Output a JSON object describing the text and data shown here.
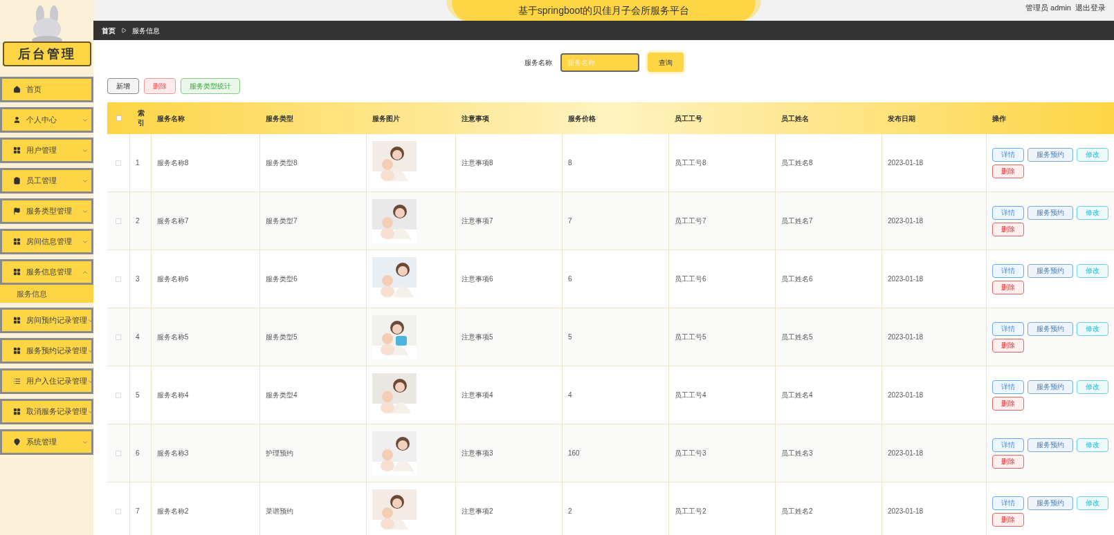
{
  "header": {
    "title": "基于springboot的贝佳月子会所服务平台",
    "user": "管理员 admin",
    "logout": "退出登录"
  },
  "sidebar": {
    "title": "后台管理",
    "menu": [
      {
        "label": "首页"
      },
      {
        "label": "个人中心",
        "expanded": false
      },
      {
        "label": "用户管理",
        "expanded": false
      },
      {
        "label": "员工管理",
        "expanded": false
      },
      {
        "label": "服务类型管理",
        "expanded": false
      },
      {
        "label": "房间信息管理",
        "expanded": false
      },
      {
        "label": "服务信息管理",
        "expanded": true,
        "children": [
          {
            "label": "服务信息",
            "selected": true
          }
        ]
      },
      {
        "label": "房间预约记录管理",
        "expanded": false
      },
      {
        "label": "服务预约记录管理",
        "expanded": false
      },
      {
        "label": "用户入住记录管理",
        "expanded": false
      },
      {
        "label": "取消服务记录管理",
        "expanded": false
      },
      {
        "label": "系统管理",
        "expanded": false
      }
    ]
  },
  "breadcrumb": [
    "首页",
    "服务信息"
  ],
  "search": {
    "label": "服务名称",
    "placeholder": "服务名称",
    "button": "查询"
  },
  "actions": [
    {
      "label": "新增",
      "kind": "default"
    },
    {
      "label": "删除",
      "kind": "danger"
    },
    {
      "label": "服务类型统计",
      "kind": "success"
    }
  ],
  "table": {
    "all_checked": false,
    "columns": [
      "索引",
      "服务名称",
      "服务类型",
      "服务图片",
      "注意事项",
      "服务价格",
      "员工工号",
      "员工姓名",
      "发布日期",
      "操作"
    ],
    "rows": [
      {
        "checked": false,
        "index": "1",
        "name": "服务名称8",
        "type": "服务类型8",
        "notes": "注意事项8",
        "price": "8",
        "emp_no": "员工工号8",
        "emp_name": "员工姓名8",
        "date": "2023-01-18",
        "ops": [
          {
            "label": "详情",
            "kind": "info"
          },
          {
            "label": "服务预约",
            "kind": "primary"
          },
          {
            "label": "修改",
            "kind": "edit"
          },
          {
            "label": "删除",
            "kind": "danger"
          }
        ]
      },
      {
        "checked": false,
        "index": "2",
        "name": "服务名称7",
        "type": "服务类型7",
        "notes": "注意事项7",
        "price": "7",
        "emp_no": "员工工号7",
        "emp_name": "员工姓名7",
        "date": "2023-01-18",
        "ops": [
          {
            "label": "详情",
            "kind": "info"
          },
          {
            "label": "服务预约",
            "kind": "primary"
          },
          {
            "label": "修改",
            "kind": "edit"
          },
          {
            "label": "删除",
            "kind": "danger"
          }
        ]
      },
      {
        "checked": false,
        "index": "3",
        "name": "服务名称6",
        "type": "服务类型6",
        "notes": "注意事项6",
        "price": "6",
        "emp_no": "员工工号6",
        "emp_name": "员工姓名6",
        "date": "2023-01-18",
        "ops": [
          {
            "label": "详情",
            "kind": "info"
          },
          {
            "label": "服务预约",
            "kind": "primary"
          },
          {
            "label": "修改",
            "kind": "edit"
          },
          {
            "label": "删除",
            "kind": "danger"
          }
        ]
      },
      {
        "checked": false,
        "index": "4",
        "name": "服务名称5",
        "type": "服务类型5",
        "notes": "注意事项5",
        "price": "5",
        "emp_no": "员工工号5",
        "emp_name": "员工姓名5",
        "date": "2023-01-18",
        "ops": [
          {
            "label": "详情",
            "kind": "info"
          },
          {
            "label": "服务预约",
            "kind": "primary"
          },
          {
            "label": "修改",
            "kind": "edit"
          },
          {
            "label": "删除",
            "kind": "danger"
          }
        ]
      },
      {
        "checked": false,
        "index": "5",
        "name": "服务名称4",
        "type": "服务类型4",
        "notes": "注意事项4",
        "price": "4",
        "emp_no": "员工工号4",
        "emp_name": "员工姓名4",
        "date": "2023-01-18",
        "ops": [
          {
            "label": "详情",
            "kind": "info"
          },
          {
            "label": "服务预约",
            "kind": "primary"
          },
          {
            "label": "修改",
            "kind": "edit"
          },
          {
            "label": "删除",
            "kind": "danger"
          }
        ]
      },
      {
        "checked": false,
        "index": "6",
        "name": "服务名称3",
        "type": "护理预约",
        "notes": "注意事项3",
        "price": "160",
        "emp_no": "员工工号3",
        "emp_name": "员工姓名3",
        "date": "2023-01-18",
        "ops": [
          {
            "label": "详情",
            "kind": "info"
          },
          {
            "label": "服务预约",
            "kind": "primary"
          },
          {
            "label": "修改",
            "kind": "edit"
          },
          {
            "label": "删除",
            "kind": "danger"
          }
        ]
      },
      {
        "checked": false,
        "index": "7",
        "name": "服务名称2",
        "type": "菜谱预约",
        "notes": "注意事项2",
        "price": "2",
        "emp_no": "员工工号2",
        "emp_name": "员工姓名2",
        "date": "2023-01-18",
        "ops": [
          {
            "label": "详情",
            "kind": "info"
          },
          {
            "label": "服务预约",
            "kind": "primary"
          },
          {
            "label": "修改",
            "kind": "edit"
          },
          {
            "label": "删除",
            "kind": "danger"
          }
        ]
      }
    ]
  }
}
